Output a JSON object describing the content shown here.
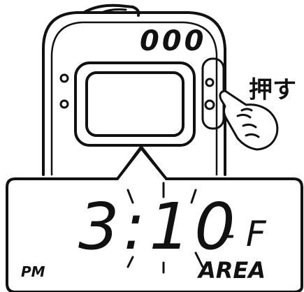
{
  "device": {
    "top_indicators": "000",
    "action_label": "押す"
  },
  "display": {
    "time": "3:10",
    "suffix": "- F",
    "period": "PM",
    "mode": "AREA"
  },
  "colors": {
    "ink": "#111111",
    "paper": "#ffffff"
  }
}
